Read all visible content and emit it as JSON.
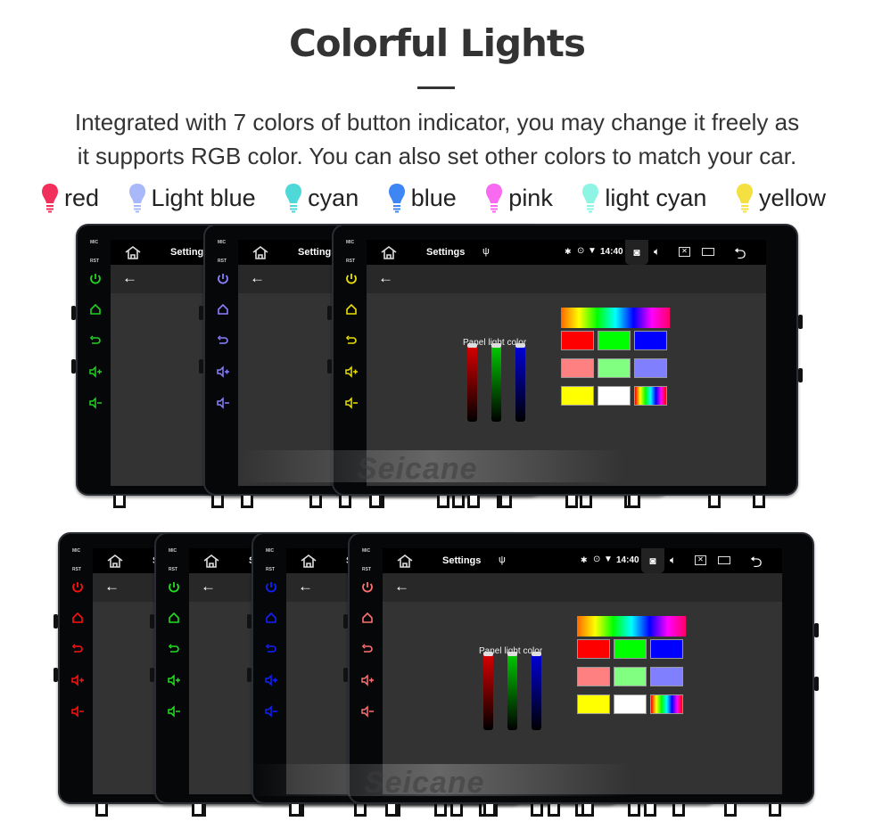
{
  "title": "Colorful Lights",
  "description": [
    "Integrated with 7 colors of button indicator, you may change it freely as",
    "it supports RGB color. You can also set other colors to match your car."
  ],
  "legend": [
    {
      "label": "red",
      "color": "#f0305a",
      "icon": "bulb-icon"
    },
    {
      "label": "Light blue",
      "color": "#a8b8f8",
      "icon": "bulb-icon"
    },
    {
      "label": "cyan",
      "color": "#4ed8d8",
      "icon": "bulb-icon"
    },
    {
      "label": "blue",
      "color": "#3f86f5",
      "icon": "bulb-icon"
    },
    {
      "label": "pink",
      "color": "#f86af0",
      "icon": "bulb-icon"
    },
    {
      "label": "light cyan",
      "color": "#8ef5e4",
      "icon": "bulb-icon"
    },
    {
      "label": "yellow",
      "color": "#f4e040",
      "icon": "bulb-icon"
    }
  ],
  "device": {
    "mic_label": "MIC",
    "rst_label": "RST",
    "status_title": "Settings",
    "time": "14:40",
    "panel_label": "Panel light color",
    "side_buttons": [
      "power-icon",
      "home-icon",
      "back-icon",
      "volume-up-icon",
      "volume-down-icon"
    ],
    "status_icons": [
      "home-icon",
      "usb-icon",
      "bluetooth-icon",
      "location-icon",
      "wifi-icon",
      "camera-icon",
      "volume-icon",
      "close-window-icon",
      "recent-apps-icon",
      "return-icon"
    ],
    "palette": [
      "#ff0000",
      "#00ff00",
      "#0000ff",
      "#ff8080",
      "#80ff80",
      "#8080ff",
      "#ffff00",
      "#ffffff",
      "rainbow"
    ],
    "slider_colors": [
      "#e00000",
      "#00d000",
      "#0000e0"
    ]
  },
  "top_row_button_colors": [
    "#22d022",
    "#8a80ff",
    "#e8e000"
  ],
  "bottom_row_button_colors": [
    "#ff1010",
    "#20e020",
    "#1020ff",
    "#ff7070"
  ],
  "watermark": "Seicane"
}
